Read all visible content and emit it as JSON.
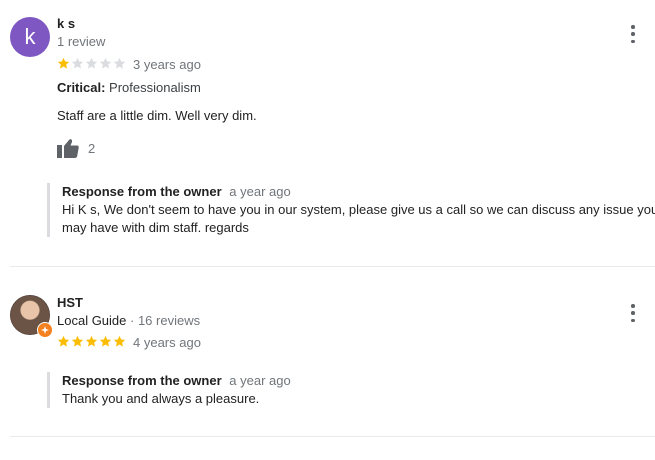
{
  "reviews": [
    {
      "avatar_letter": "k",
      "avatar_color": "#7e57c2",
      "name": "k s",
      "sub": "1 review",
      "rating": 1,
      "date": "3 years ago",
      "critical_label": "Critical:",
      "critical_value": "Professionalism",
      "text": "Staff are a little dim. Well very dim.",
      "likes": "2",
      "response": {
        "title": "Response from the owner",
        "date": "a year ago",
        "line1": "Hi K s, We don't seem to have you in our system, please give us a call so we can discuss any issue you",
        "line2": "may have with dim staff. regards"
      }
    },
    {
      "name": "HST",
      "guide_label": "Local Guide",
      "sub": "· 16 reviews",
      "rating": 5,
      "date": "4 years ago",
      "response": {
        "title": "Response from the owner",
        "date": "a year ago",
        "text": "Thank you and always a pleasure."
      }
    }
  ],
  "colors": {
    "star_filled": "#fbbc04",
    "star_empty": "#dadce0",
    "guide_badge": "#f4811f"
  },
  "icons": [
    "more-vert-icon",
    "thumb-up-icon",
    "star-icon",
    "local-guide-badge-icon"
  ]
}
